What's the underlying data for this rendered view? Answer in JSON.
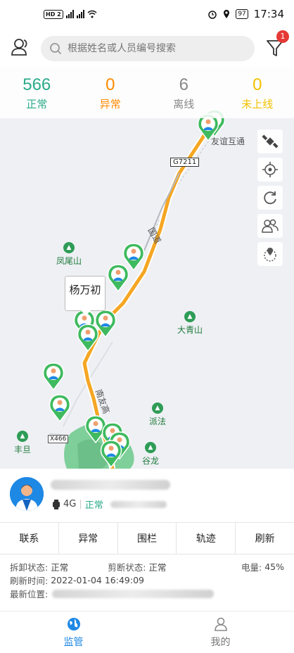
{
  "status_bar": {
    "network_left": "HD 2",
    "time": "17:34",
    "battery": "97"
  },
  "search": {
    "placeholder": "根据姓名或人员编号搜索",
    "filter_badge": "1"
  },
  "stats": [
    {
      "value": "566",
      "label": "正常",
      "color": "#2bab8a"
    },
    {
      "value": "0",
      "label": "异常",
      "color": "#ff8a00"
    },
    {
      "value": "6",
      "label": "离线",
      "color": "#888888"
    },
    {
      "value": "0",
      "label": "未上线",
      "color": "#f2c200"
    }
  ],
  "map": {
    "highway": "G7211",
    "road_name": "国道",
    "places": [
      "凤尾山",
      "大青山",
      "派法",
      "丰旦",
      "谷龙",
      "X466",
      "南友高",
      "友谊互通"
    ],
    "callout_name": "杨万初",
    "tools": [
      "satellite-icon",
      "locate-icon",
      "refresh-icon",
      "group-icon",
      "fence-pin-icon"
    ]
  },
  "person": {
    "network": "4G",
    "status": "正常"
  },
  "actions": [
    "联系",
    "异常",
    "围栏",
    "轨迹",
    "刷新"
  ],
  "details": {
    "dismantle_label": "拆卸状态:",
    "dismantle_value": "正常",
    "cut_label": "剪断状态:",
    "cut_value": "正常",
    "battery_label": "电量:",
    "battery_value": "45%",
    "refresh_label": "刷新时间:",
    "refresh_value": "2022-01-04 16:49:09",
    "location_label": "最新位置:"
  },
  "tabs": [
    {
      "label": "监管",
      "icon": "globe-icon",
      "active": true
    },
    {
      "label": "我的",
      "icon": "person-icon",
      "active": false
    }
  ]
}
